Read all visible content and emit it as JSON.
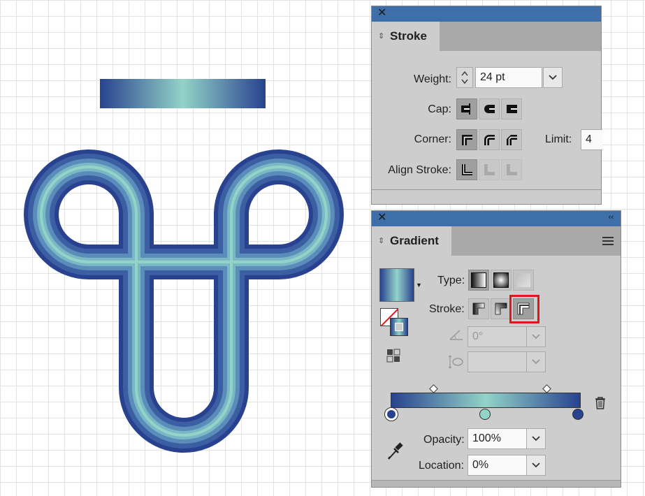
{
  "colors": {
    "gradient_dark": "#28428f",
    "gradient_light": "#93d3c8",
    "panel_bg": "#cdcdcd",
    "panel_title_bar": "#3e6fa8",
    "highlight": "#e0161b"
  },
  "stroke_panel": {
    "tab_title": "Stroke",
    "weight_label": "Weight:",
    "weight_value": "24 pt",
    "cap_label": "Cap:",
    "cap_options": [
      "butt-cap-icon",
      "round-cap-icon",
      "projecting-cap-icon"
    ],
    "corner_label": "Corner:",
    "corner_options": [
      "miter-join-icon",
      "round-join-icon",
      "bevel-join-icon"
    ],
    "limit_label": "Limit:",
    "limit_value": "4",
    "align_label": "Align Stroke:",
    "align_options": [
      "align-center-icon",
      "align-inside-icon",
      "align-outside-icon"
    ]
  },
  "gradient_panel": {
    "tab_title": "Gradient",
    "type_label": "Type:",
    "type_options": [
      "linear-gradient-icon",
      "radial-gradient-icon",
      "freeform-gradient-icon"
    ],
    "stroke_label": "Stroke:",
    "stroke_options": [
      "gradient-within-stroke-icon",
      "gradient-along-stroke-icon",
      "gradient-across-stroke-icon"
    ],
    "selected_stroke_option": "gradient-across-stroke-icon",
    "angle_value": "0°",
    "opacity_label": "Opacity:",
    "opacity_value": "100%",
    "location_label": "Location:",
    "location_value": "0%",
    "stops": [
      {
        "location": 0,
        "color": "#28428f"
      },
      {
        "location": 50,
        "color": "#93d3c8"
      },
      {
        "location": 100,
        "color": "#28428f"
      }
    ]
  }
}
